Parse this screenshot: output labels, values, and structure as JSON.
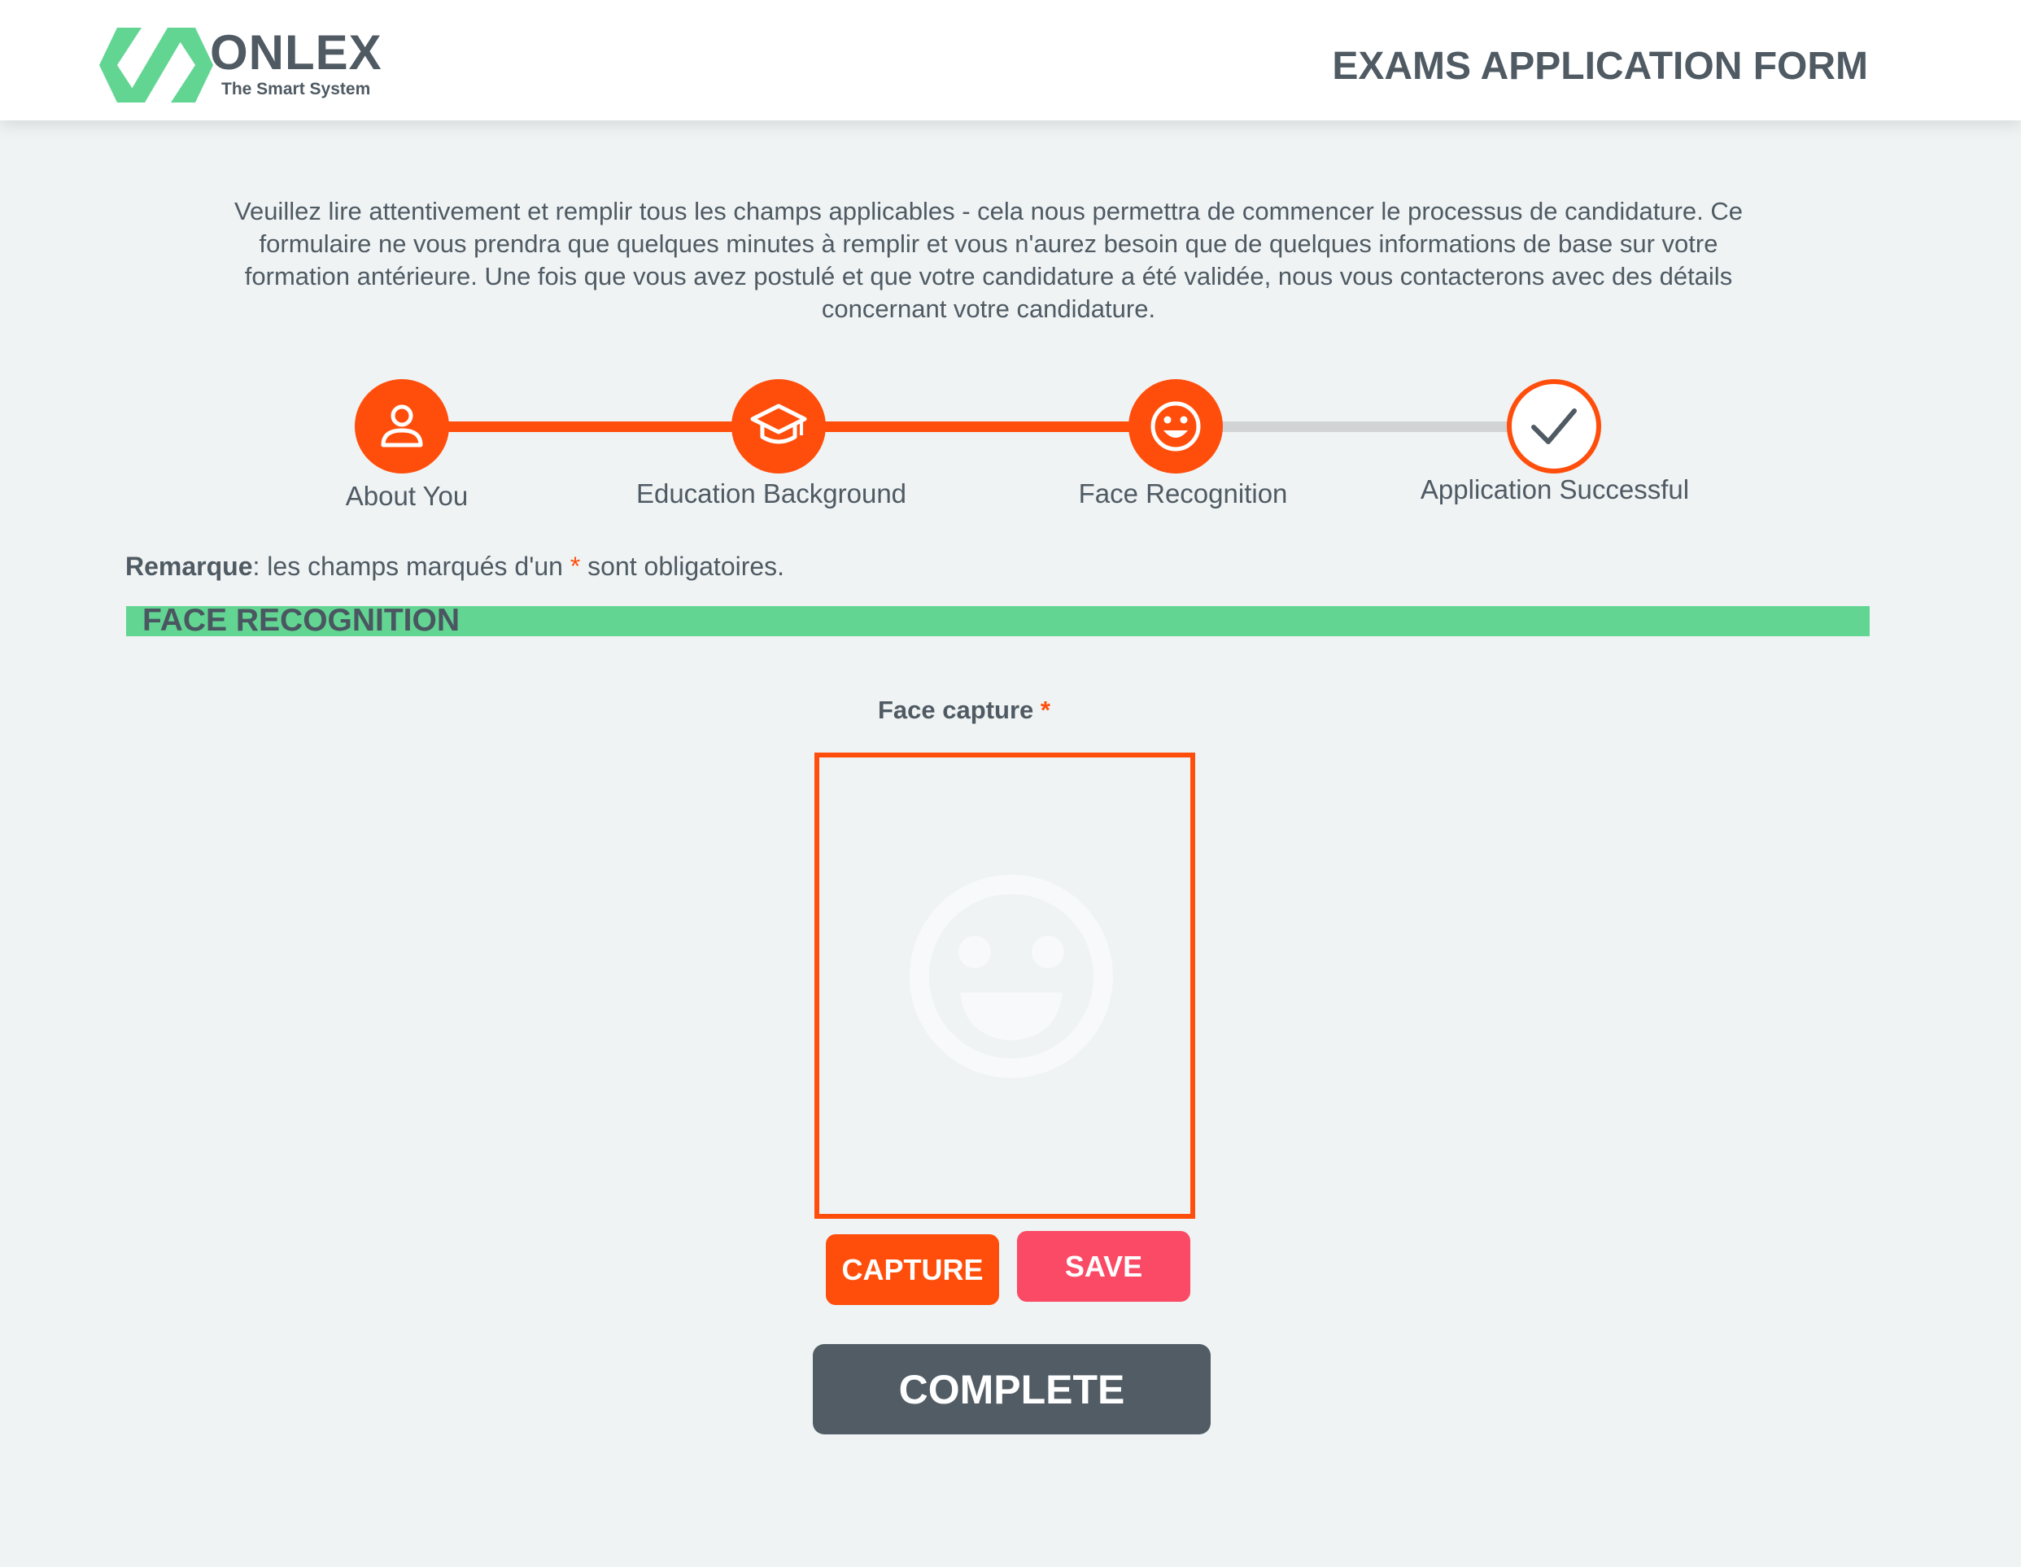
{
  "header": {
    "brand_name": "ONLEX",
    "brand_tagline": "The Smart System",
    "form_title": "EXAMS APPLICATION FORM"
  },
  "intro": {
    "text": "Veuillez lire attentivement et remplir tous les champs applicables - cela nous permettra de commencer le processus de candidature. Ce formulaire ne vous prendra que quelques minutes à remplir et vous n'aurez besoin que de quelques informations de base sur votre formation antérieure. Une fois que vous avez postulé et que votre candidature a été validée, nous vous contacterons avec des détails concernant votre candidature."
  },
  "steps": [
    {
      "label": "About You",
      "icon": "user-icon",
      "state": "completed"
    },
    {
      "label": "Education Background",
      "icon": "graduation-cap-icon",
      "state": "completed"
    },
    {
      "label": "Face Recognition",
      "icon": "smiley-icon",
      "state": "current"
    },
    {
      "label": "Application Successful",
      "icon": "checkmark-icon",
      "state": "pending"
    }
  ],
  "note": {
    "bold": "Remarque",
    "before_star": ": les champs marqués d'un ",
    "star": "*",
    "after_star": " sont obligatoires."
  },
  "section": {
    "title": "FACE RECOGNITION"
  },
  "face_capture": {
    "label": "Face capture",
    "required_marker": "*",
    "placeholder_icon": "smiley-face-icon"
  },
  "buttons": {
    "capture": "CAPTURE",
    "save": "SAVE",
    "complete": "COMPLETE"
  },
  "colors": {
    "accent": "#ff4e0b",
    "brand_green": "#63d593",
    "save": "#fb4a66",
    "complete": "#515c65",
    "text": "#4f5a63",
    "background": "#eff3f4"
  }
}
